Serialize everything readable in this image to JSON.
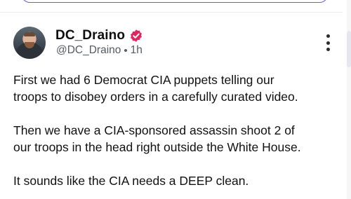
{
  "post": {
    "display_name": "DC_Draino",
    "handle": "@DC_Draino",
    "separator": "•",
    "time_ago": "1h",
    "verified_color": "#e0245e",
    "paragraphs": [
      [
        "First we had 6 Democrat CIA puppets telling our",
        "troops to disobey orders in a carefully curated video."
      ],
      [
        "Then we have a CIA-sponsored assassin shoot 2 of",
        "our troops in the head right outside the White House."
      ],
      [
        "It sounds like the CIA needs a DEEP clean."
      ]
    ]
  },
  "icons": {
    "verified": "verified-badge-icon",
    "more": "more-vertical-icon"
  },
  "colors": {
    "accent": "#6f5bd6",
    "text": "#111111",
    "muted": "#555b61"
  }
}
